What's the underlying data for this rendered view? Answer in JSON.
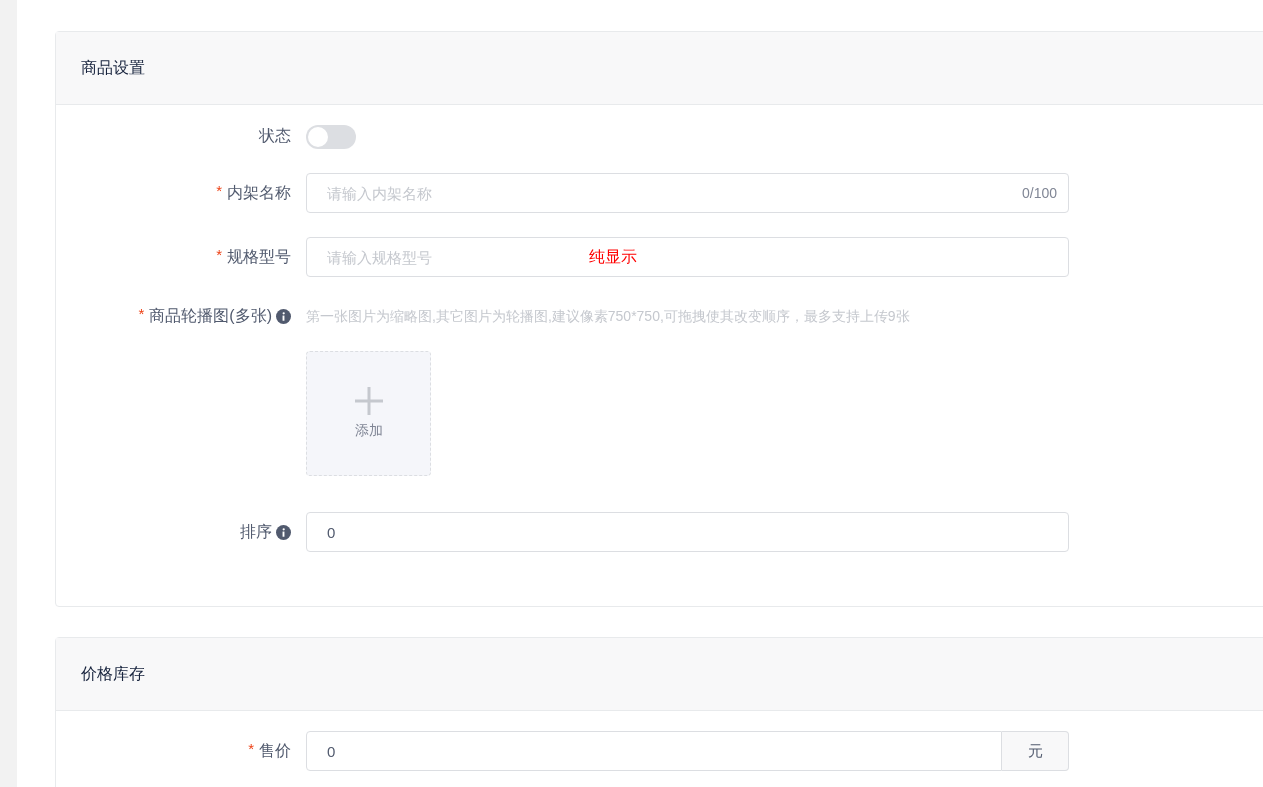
{
  "sections": [
    {
      "title": "商品设置",
      "fields": [
        {
          "kind": "switch",
          "label": "状态",
          "info": false,
          "on": false
        },
        {
          "kind": "input",
          "label": "内架名称",
          "required_mark": "*",
          "info": false,
          "placeholder": "请输入内架名称",
          "counter": "0/100"
        },
        {
          "kind": "input",
          "label": "规格型号",
          "required_mark": "*",
          "info": false,
          "placeholder": "请输入规格型号",
          "note": "纯显示"
        },
        {
          "kind": "upload",
          "label": "商品轮播图(多张)",
          "required_mark": "*",
          "info": true,
          "hint": "第一张图片为缩略图,其它图片为轮播图,建议像素750*750,可拖拽使其改变顺序，最多支持上传9张",
          "button": "添加"
        },
        {
          "kind": "input",
          "label": "排序",
          "info": true,
          "value": "0"
        }
      ]
    },
    {
      "title": "价格库存",
      "fields": [
        {
          "kind": "input",
          "label": "售价",
          "required_mark": "*",
          "info": false,
          "value": "0",
          "suffix": "元"
        }
      ]
    }
  ]
}
